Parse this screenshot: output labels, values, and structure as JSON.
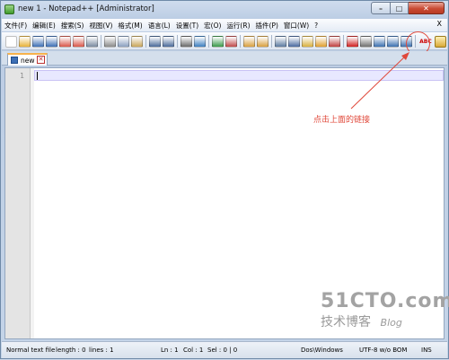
{
  "window": {
    "title": "new  1 - Notepad++ [Administrator]",
    "controls": {
      "minimize": "–",
      "maximize": "□",
      "close": "✕"
    }
  },
  "menubar": {
    "items": [
      "文件(F)",
      "编辑(E)",
      "搜索(S)",
      "视图(V)",
      "格式(M)",
      "语言(L)",
      "设置(T)",
      "宏(O)",
      "运行(R)",
      "插件(P)",
      "窗口(W)",
      "?"
    ],
    "close_label": "X"
  },
  "toolbar": {
    "spell_label": "ABC",
    "buttons": [
      {
        "icon": "new-file-icon",
        "color": "#ffffff"
      },
      {
        "icon": "open-file-icon",
        "color": "#e8b23a"
      },
      {
        "icon": "save-icon",
        "color": "#3d6fb5"
      },
      {
        "icon": "save-all-icon",
        "color": "#3d6fb5"
      },
      {
        "icon": "close-file-icon",
        "color": "#d9574a"
      },
      {
        "icon": "close-all-icon",
        "color": "#d9574a"
      },
      {
        "icon": "print-icon",
        "color": "#7a8aa0"
      },
      {
        "icon": "cut-icon",
        "color": "#8a8a8a"
      },
      {
        "icon": "copy-icon",
        "color": "#8aa0c0"
      },
      {
        "icon": "paste-icon",
        "color": "#c9a65a"
      },
      {
        "icon": "undo-icon",
        "color": "#4a6a9a"
      },
      {
        "icon": "redo-icon",
        "color": "#4a6a9a"
      },
      {
        "icon": "find-icon",
        "color": "#6a6a6a"
      },
      {
        "icon": "replace-icon",
        "color": "#3d7fc0"
      },
      {
        "icon": "zoom-in-icon",
        "color": "#3a9a4a"
      },
      {
        "icon": "zoom-out-icon",
        "color": "#c04a4a"
      },
      {
        "icon": "sync-vertical-icon",
        "color": "#d8a040"
      },
      {
        "icon": "sync-horizontal-icon",
        "color": "#d8a040"
      },
      {
        "icon": "word-wrap-icon",
        "color": "#5a7aa0"
      },
      {
        "icon": "show-all-chars-icon",
        "color": "#4a6aa0"
      },
      {
        "icon": "indent-guide-icon",
        "color": "#d8b040"
      },
      {
        "icon": "udl-icon",
        "color": "#e0a030"
      },
      {
        "icon": "doc-map-icon",
        "color": "#c04040"
      },
      {
        "icon": "record-macro-icon",
        "color": "#d02020"
      },
      {
        "icon": "stop-macro-icon",
        "color": "#707070"
      },
      {
        "icon": "play-macro-icon",
        "color": "#3a70b0"
      },
      {
        "icon": "run-macro-multiple-icon",
        "color": "#3a70b0"
      },
      {
        "icon": "save-macro-icon",
        "color": "#3a70b0"
      }
    ]
  },
  "tab": {
    "label": "new",
    "close": "✕"
  },
  "editor": {
    "line_number": "1"
  },
  "annotation": {
    "text": "点击上面的链接"
  },
  "watermark": {
    "logo": "51CTO.com",
    "sub": "技术博客",
    "blog": "Blog"
  },
  "statusbar": {
    "file_type": "Normal text file",
    "length": "length : 0",
    "lines": "lines : 1",
    "ln": "Ln : 1",
    "col": "Col : 1",
    "sel": "Sel : 0 | 0",
    "eol": "Dos\\Windows",
    "encoding": "UTF-8 w/o BOM",
    "mode": "INS"
  }
}
